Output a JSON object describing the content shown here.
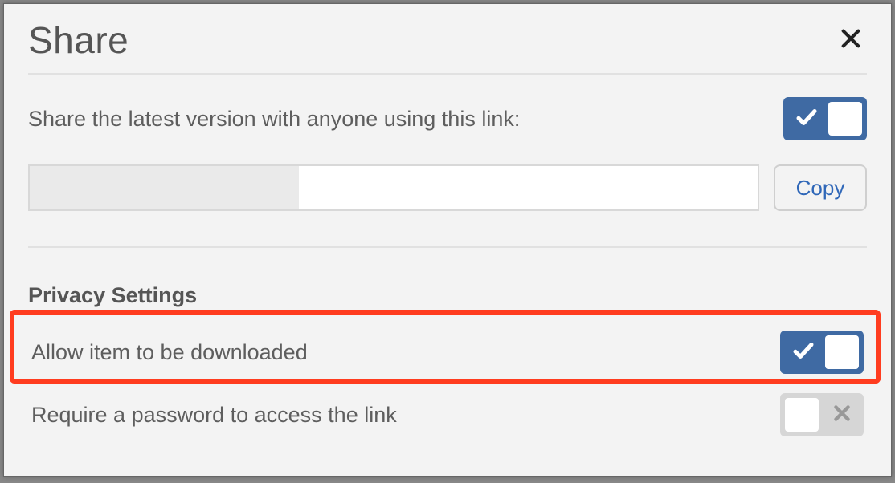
{
  "modal": {
    "title": "Share",
    "close_aria": "Close"
  },
  "share": {
    "label": "Share the latest version with anyone using this link:",
    "toggle_on": true,
    "copy_label": "Copy",
    "link_value": ""
  },
  "privacy": {
    "section_title": "Privacy Settings",
    "download": {
      "label": "Allow item to be downloaded",
      "toggle_on": true
    },
    "password": {
      "label": "Require a password to access the link",
      "toggle_on": false
    }
  },
  "highlight": {
    "target": "allow-download-row"
  }
}
